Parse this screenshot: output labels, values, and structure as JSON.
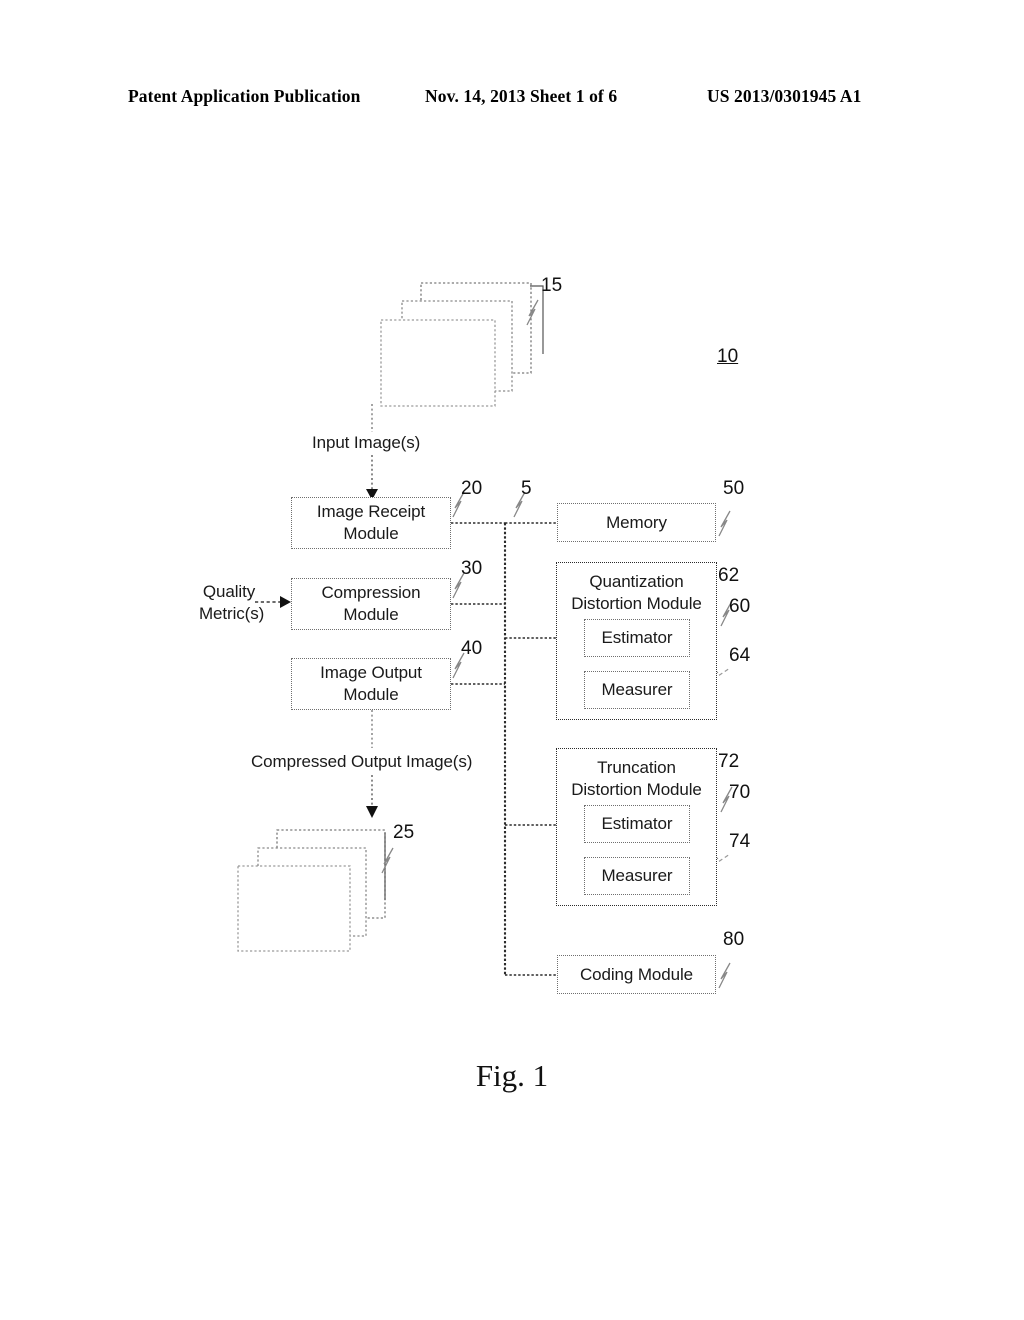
{
  "header": {
    "left": "Patent Application Publication",
    "middle": "Nov. 14, 2013  Sheet 1 of 6",
    "right": "US 2013/0301945 A1"
  },
  "figure": {
    "caption": "Fig. 1",
    "system_ref": "10",
    "input_stack": {
      "ref": "15",
      "flow_label": "Input Image(s)"
    },
    "output_stack": {
      "ref": "25",
      "flow_label": "Compressed Output Image(s)"
    },
    "external_input": {
      "label_line1": "Quality",
      "label_line2": "Metric(s)"
    },
    "bus_ref": "5",
    "modules": [
      {
        "name": "image-receipt-module",
        "line1": "Image Receipt",
        "line2": "Module",
        "ref": "20"
      },
      {
        "name": "compression-module",
        "line1": "Compression",
        "line2": "Module",
        "ref": "30"
      },
      {
        "name": "image-output-module",
        "line1": "Image Output",
        "line2": "Module",
        "ref": "40"
      },
      {
        "name": "memory",
        "line1": "Memory",
        "line2": "",
        "ref": "50"
      },
      {
        "name": "coding-module",
        "line1": "Coding Module",
        "line2": "",
        "ref": "80"
      }
    ],
    "quantization_distortion_module": {
      "title_line1": "Quantization",
      "title_line2": "Distortion Module",
      "ref": "60",
      "estimator": {
        "label": "Estimator",
        "ref": "62"
      },
      "measurer": {
        "label": "Measurer",
        "ref": "64"
      }
    },
    "truncation_distortion_module": {
      "title_line1": "Truncation",
      "title_line2": "Distortion Module",
      "ref": "70",
      "estimator": {
        "label": "Estimator",
        "ref": "72"
      },
      "measurer": {
        "label": "Measurer",
        "ref": "74"
      }
    }
  },
  "colors": {
    "ink": "#111111",
    "box_border": "#6f6f6f",
    "outer_border": "#2b2b2b",
    "background": "#ffffff"
  }
}
